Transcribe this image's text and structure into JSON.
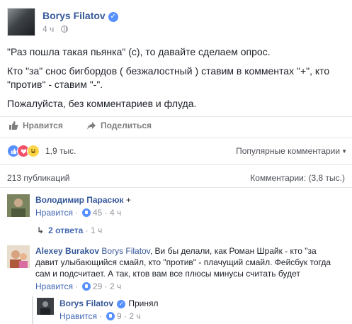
{
  "post": {
    "author": "Borys Filatov",
    "time": "4 ч",
    "paragraphs": [
      "\"Раз пошла такая пьянка\" (с), то давайте сделаем опрос.",
      "Кто \"за\" снос бигбордов ( безжалостный ) ставим в комментах \"+\", кто \"против\" - ставим \"-\".",
      "Пожалуйста, без комментариев и флуда."
    ]
  },
  "actions": {
    "like": "Нравится",
    "share": "Поделиться"
  },
  "reactions": {
    "count": "1,9 тыс.",
    "sort": "Популярные комментарии"
  },
  "counts": {
    "publications": "213 публикаций",
    "comments": "Комментарии: (3,8 тыс.)"
  },
  "comments": [
    {
      "author": "Володимир Парасюк",
      "text": "+",
      "like": "Нравится",
      "likes": "45",
      "time": "4 ч",
      "replies": "2 ответа",
      "replies_time": "1 ч"
    },
    {
      "author": "Alexey Burakov",
      "mention": "Borys Filatov",
      "text": ", Ви бы делали, как Роман Шрайк - кто \"за давит улыбающийся смайл, кто \"против\" - плачущий смайл. Фейсбук тогда сам и подсчитает. А так, ктов вам все плюсы минусы считать будет",
      "like": "Нравится",
      "likes": "29",
      "time": "2 ч"
    },
    {
      "author": "Borys Filatov",
      "text": "Принял",
      "like": "Нравится",
      "likes": "9",
      "time": "2 ч"
    }
  ],
  "colors": {
    "link": "#365899",
    "muted": "#90949c",
    "like_blue": "#5890ff"
  }
}
